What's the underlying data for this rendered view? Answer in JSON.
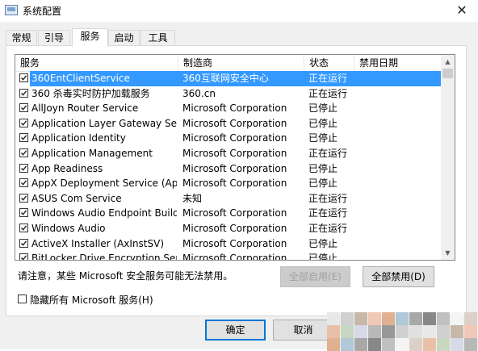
{
  "window": {
    "title": "系统配置",
    "close_glyph": "✕"
  },
  "tabs": [
    {
      "label": "常规"
    },
    {
      "label": "引导"
    },
    {
      "label": "服务"
    },
    {
      "label": "启动"
    },
    {
      "label": "工具"
    }
  ],
  "active_tab": "服务",
  "columns": [
    "服务",
    "制造商",
    "状态",
    "禁用日期"
  ],
  "services": [
    {
      "name": "360EntClientService",
      "vendor": "360互联网安全中心",
      "status": "正在运行",
      "checked": true,
      "selected": true
    },
    {
      "name": "360 杀毒实时防护加载服务",
      "vendor": "360.cn",
      "status": "正在运行",
      "checked": true
    },
    {
      "name": "AllJoyn Router Service",
      "vendor": "Microsoft Corporation",
      "status": "已停止",
      "checked": true
    },
    {
      "name": "Application Layer Gateway Service",
      "vendor": "Microsoft Corporation",
      "status": "已停止",
      "checked": true
    },
    {
      "name": "Application Identity",
      "vendor": "Microsoft Corporation",
      "status": "已停止",
      "checked": true
    },
    {
      "name": "Application Management",
      "vendor": "Microsoft Corporation",
      "status": "正在运行",
      "checked": true
    },
    {
      "name": "App Readiness",
      "vendor": "Microsoft Corporation",
      "status": "已停止",
      "checked": true
    },
    {
      "name": "AppX Deployment Service (AppX...",
      "vendor": "Microsoft Corporation",
      "status": "已停止",
      "checked": true
    },
    {
      "name": "ASUS Com Service",
      "vendor": "未知",
      "status": "正在运行",
      "checked": true
    },
    {
      "name": "Windows Audio Endpoint Builder",
      "vendor": "Microsoft Corporation",
      "status": "正在运行",
      "checked": true
    },
    {
      "name": "Windows Audio",
      "vendor": "Microsoft Corporation",
      "status": "正在运行",
      "checked": true
    },
    {
      "name": "ActiveX Installer (AxInstSV)",
      "vendor": "Microsoft Corporation",
      "status": "已停止",
      "checked": true
    },
    {
      "name": "BitLocker Drive Encryption Service",
      "vendor": "Microsoft Corporation",
      "status": "已停止",
      "checked": true
    }
  ],
  "note": "请注意，某些 Microsoft 安全服务可能无法禁用。",
  "buttons": {
    "enable_all": "全部启用(E)",
    "disable_all": "全部禁用(D)",
    "ok": "确定",
    "cancel": "取消"
  },
  "hide_ms_label": "隐藏所有 Microsoft 服务(H)",
  "colors": {
    "selection": "#3399ff",
    "default_button_border": "#0078d7"
  }
}
